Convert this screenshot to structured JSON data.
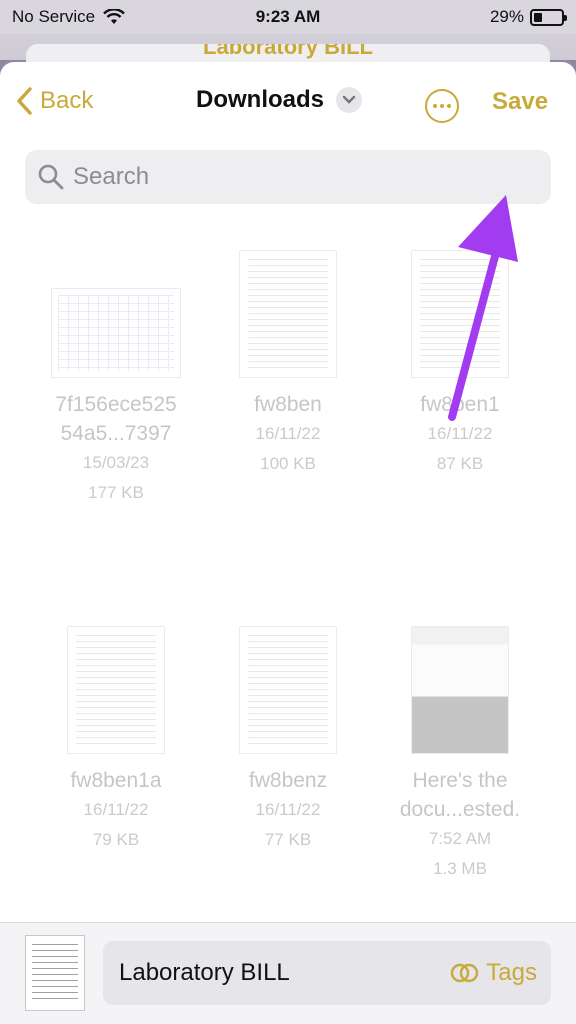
{
  "status_bar": {
    "carrier": "No Service",
    "time": "9:23 AM",
    "battery": "29%",
    "battery_level": 0.29
  },
  "background_title": "Laboratory BILL",
  "nav": {
    "back_label": "Back",
    "title": "Downloads",
    "save_label": "Save"
  },
  "search": {
    "placeholder": "Search"
  },
  "files": [
    {
      "name_line1": "7f156ece525",
      "name_line2": "54a5...7397",
      "date": "15/03/23",
      "size": "177 KB",
      "thumb": "spreadsheet"
    },
    {
      "name_line1": "fw8ben",
      "name_line2": "",
      "date": "16/11/22",
      "size": "100 KB",
      "thumb": "form"
    },
    {
      "name_line1": "fw8ben1",
      "name_line2": "",
      "date": "16/11/22",
      "size": "87 KB",
      "thumb": "form"
    },
    {
      "name_line1": "fw8ben1a",
      "name_line2": "",
      "date": "16/11/22",
      "size": "79 KB",
      "thumb": "form"
    },
    {
      "name_line1": "fw8benz",
      "name_line2": "",
      "date": "16/11/22",
      "size": "77 KB",
      "thumb": "form"
    },
    {
      "name_line1": "Here's the",
      "name_line2": "docu...ested.",
      "date": "7:52 AM",
      "size": "1.3 MB",
      "thumb": "screenshot"
    },
    {
      "name_line1": "",
      "name_line2": "",
      "date": "",
      "size": "",
      "thumb": "photo-dark"
    },
    {
      "name_line1": "",
      "name_line2": "",
      "date": "",
      "size": "",
      "thumb": "photo-pink"
    },
    {
      "name_line1": "",
      "name_line2": "",
      "date": "",
      "size": "",
      "thumb": "photo-cat"
    }
  ],
  "bottom": {
    "file_name": "Laboratory BILL",
    "tags_label": "Tags"
  },
  "colors": {
    "accent": "#c9a93a",
    "annotation_arrow": "#a23cf0"
  }
}
